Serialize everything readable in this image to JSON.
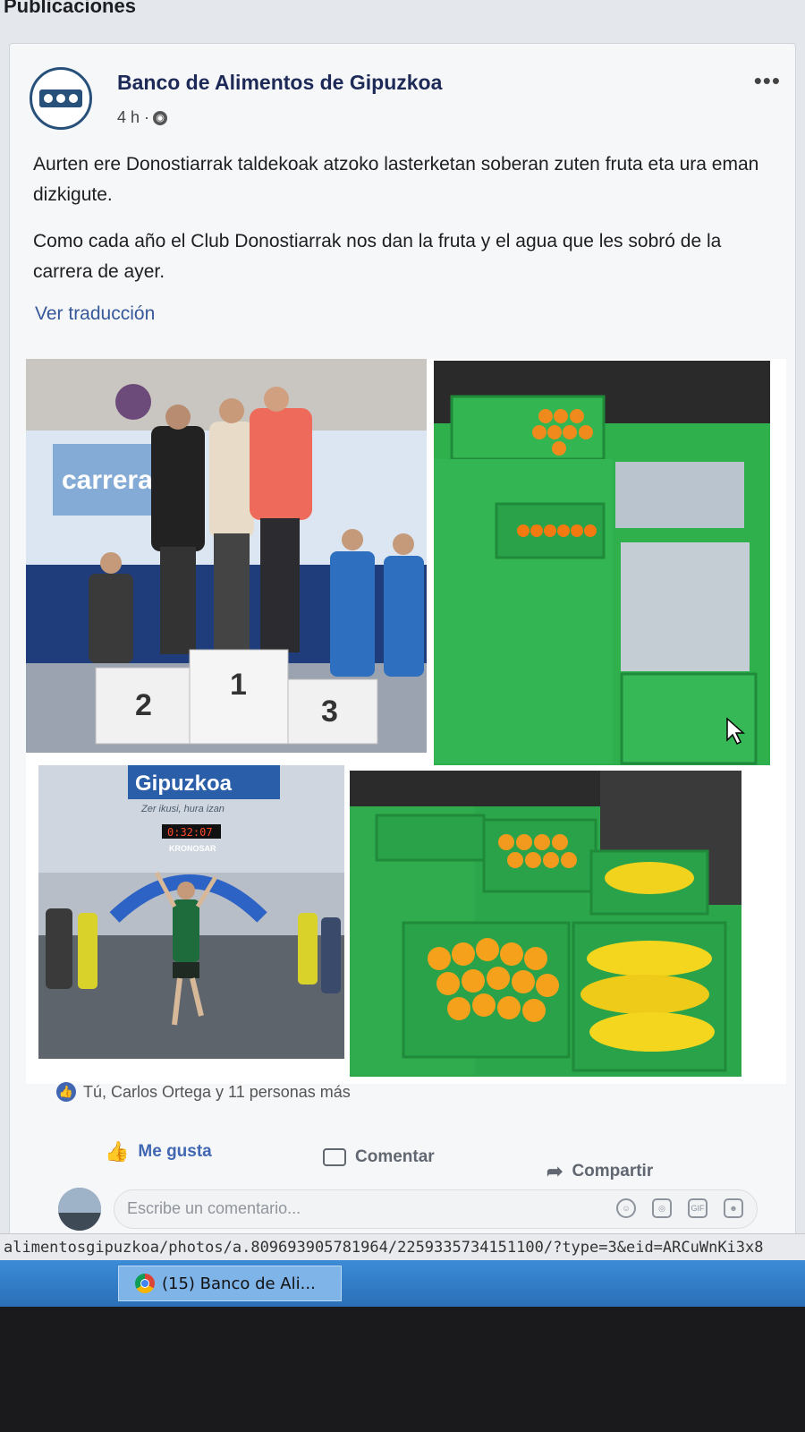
{
  "section": {
    "title": "Publicaciones"
  },
  "post": {
    "page_name": "Banco de Alimentos de Gipuzkoa",
    "time": "4 h ·",
    "more": "•••",
    "text_eu": "Aurten ere Donostiarrak taldekoak atzoko lasterketan soberan zuten fruta eta ura eman dizkigute.",
    "text_es": "Como cada año el Club Donostiarrak nos dan la fruta y el agua que les sobró de la carrera de ayer.",
    "translate": "Ver traducción",
    "photos": {
      "banner_text": "carrera",
      "podium": [
        "2",
        "1",
        "3"
      ],
      "gipuzkoa_text": "Gipuzkoa",
      "gipuzkoa_sub": "Zer ikusi, hura izan",
      "timer": "0:32:07",
      "sponsor": "KRONOSAR"
    },
    "reactions": "Tú, Carlos Ortega y 11 personas más",
    "actions": {
      "like": "Me gusta",
      "comment": "Comentar",
      "share": "Compartir"
    },
    "comment_placeholder": "Escribe un comentario...",
    "comment_icons": {
      "gif": "GIF"
    }
  },
  "status_url": "alimentosgipuzkoa/photos/a.809693905781964/2259335734151100/?type=3&eid=ARCuWnKi3x8",
  "taskbar": {
    "tab_label": "(15) Banco de Ali..."
  },
  "colors": {
    "link": "#365899",
    "accent": "#4267b2",
    "crate": "#2fb04d"
  }
}
